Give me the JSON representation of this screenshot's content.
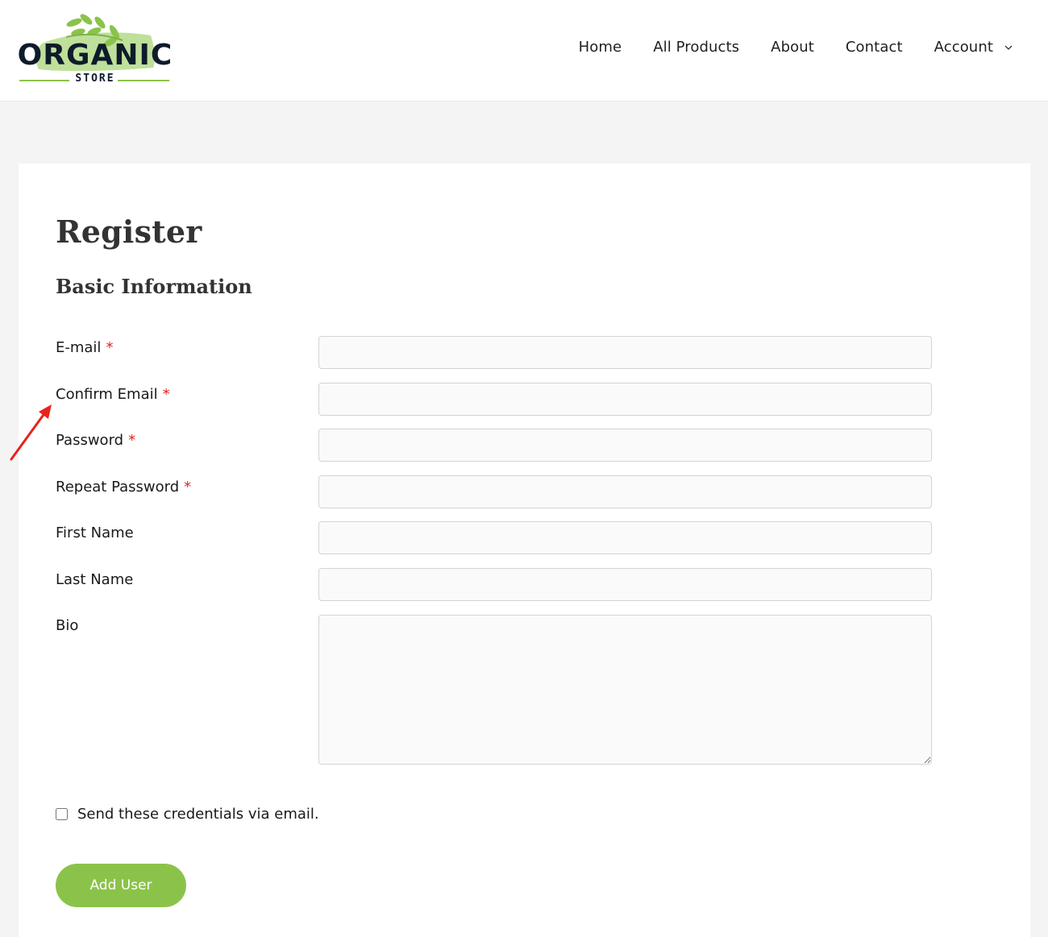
{
  "brand": {
    "logo_main": "ORGANIC",
    "logo_sub": "STORE",
    "accent_color": "#8bc34a",
    "logo_text_color": "#0f1b2b"
  },
  "nav": {
    "items": [
      {
        "label": "Home"
      },
      {
        "label": "All Products"
      },
      {
        "label": "About"
      },
      {
        "label": "Contact"
      },
      {
        "label": "Account",
        "has_dropdown": true,
        "icon": "chevron-down-icon"
      }
    ]
  },
  "page": {
    "title": "Register",
    "section_title": "Basic Information"
  },
  "form": {
    "fields": [
      {
        "label": "E-mail",
        "required": true,
        "required_mark": "*",
        "value": "",
        "type": "email"
      },
      {
        "label": "Confirm Email",
        "required": true,
        "required_mark": "*",
        "value": "",
        "type": "email"
      },
      {
        "label": "Password",
        "required": true,
        "required_mark": "*",
        "value": "",
        "type": "password"
      },
      {
        "label": "Repeat Password",
        "required": true,
        "required_mark": "*",
        "value": "",
        "type": "password"
      },
      {
        "label": "First Name",
        "required": false,
        "value": "",
        "type": "text"
      },
      {
        "label": "Last Name",
        "required": false,
        "value": "",
        "type": "text"
      },
      {
        "label": "Bio",
        "required": false,
        "value": "",
        "type": "textarea"
      }
    ],
    "send_credentials": {
      "label": "Send these credentials via email.",
      "checked": false
    },
    "submit_label": "Add User"
  },
  "annotation": {
    "type": "red-arrow",
    "color": "#e2231a",
    "points_to": "Confirm Email"
  }
}
